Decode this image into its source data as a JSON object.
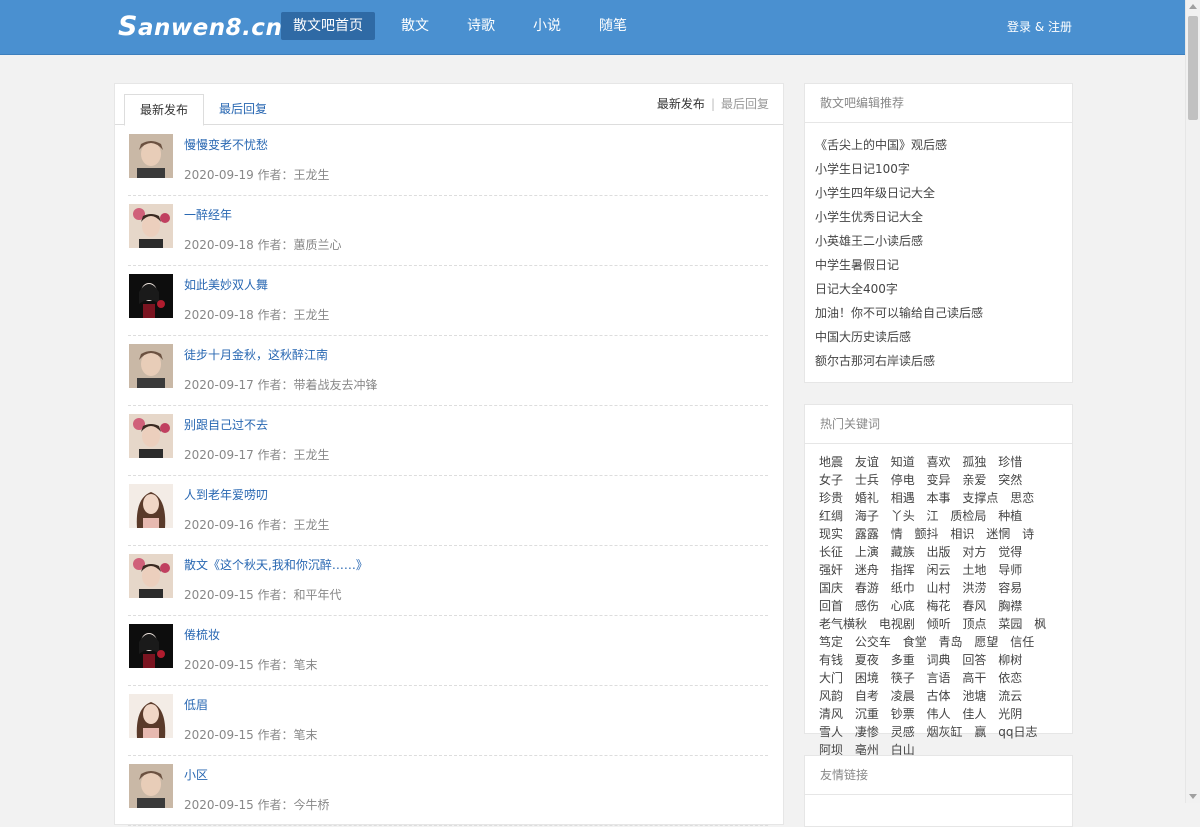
{
  "header": {
    "logo_first": "S",
    "logo_rest": "anwen8.cn",
    "nav": [
      {
        "label": "散文吧首页",
        "active": true
      },
      {
        "label": "散文",
        "active": false
      },
      {
        "label": "诗歌",
        "active": false
      },
      {
        "label": "小说",
        "active": false
      },
      {
        "label": "随笔",
        "active": false
      }
    ],
    "login": "登录 & 注册"
  },
  "main": {
    "tabs": [
      "最新发布",
      "最后回复"
    ],
    "sort": {
      "on": "最新发布",
      "separator": "|",
      "off": "最后回复"
    },
    "articles": [
      {
        "title": "慢慢变老不忧愁",
        "meta": "2020-09-19 作者：王龙生",
        "avatar": "woman-short-hair"
      },
      {
        "title": "一醉经年",
        "meta": "2020-09-18 作者：蕙质兰心",
        "avatar": "woman-flowers"
      },
      {
        "title": "如此美妙双人舞",
        "meta": "2020-09-18 作者：王龙生",
        "avatar": "doll-rose"
      },
      {
        "title": "徒步十月金秋，这秋醉江南",
        "meta": "2020-09-17 作者：带着战友去冲锋",
        "avatar": "woman-short-hair"
      },
      {
        "title": "别跟自己过不去",
        "meta": "2020-09-17 作者：王龙生",
        "avatar": "woman-flowers"
      },
      {
        "title": "人到老年爱唠叨",
        "meta": "2020-09-16 作者：王龙生",
        "avatar": "woman-long-hair"
      },
      {
        "title": "散文《这个秋天,我和你沉醉……》",
        "meta": "2020-09-15 作者：和平年代",
        "avatar": "woman-flowers"
      },
      {
        "title": "倦梳妆",
        "meta": "2020-09-15 作者：笔末",
        "avatar": "doll-rose"
      },
      {
        "title": "低眉",
        "meta": "2020-09-15 作者：笔末",
        "avatar": "woman-long-hair"
      },
      {
        "title": "小区",
        "meta": "2020-09-15 作者：今牛桥",
        "avatar": "woman-short-hair"
      }
    ]
  },
  "sidebar": {
    "recommend_title": "散文吧编辑推荐",
    "recommend": [
      "《舌尖上的中国》观后感",
      "小学生日记100字",
      "小学生四年级日记大全",
      "小学生优秀日记大全",
      "小英雄王二小读后感",
      "中学生暑假日记",
      "日记大全400字",
      "加油！你不可以输给自己读后感",
      "中国大历史读后感",
      "额尔古那河右岸读后感"
    ],
    "keywords_title": "热门关键词",
    "keywords": [
      "地震",
      "友谊",
      "知道",
      "喜欢",
      "孤独",
      "珍惜",
      "女子",
      "士兵",
      "停电",
      "变异",
      "亲爱",
      "突然",
      "珍贵",
      "婚礼",
      "相遇",
      "本事",
      "支撑点",
      "思恋",
      "红绸",
      "海子",
      "丫头",
      "江",
      "质检局",
      "种植",
      "现实",
      "露露",
      "情",
      "颤抖",
      "相识",
      "迷惘",
      "诗",
      "长征",
      "上演",
      "藏族",
      "出版",
      "对方",
      "觉得",
      "强奸",
      "迷舟",
      "指挥",
      "闲云",
      "土地",
      "导师",
      "国庆",
      "春游",
      "纸巾",
      "山村",
      "洪涝",
      "容易",
      "回首",
      "感伤",
      "心底",
      "梅花",
      "春风",
      "胸襟",
      "老气横秋",
      "电视剧",
      "倾听",
      "顶点",
      "菜园",
      "枫",
      "笃定",
      "公交车",
      "食堂",
      "青岛",
      "愿望",
      "信任",
      "有钱",
      "夏夜",
      "多重",
      "词典",
      "回答",
      "柳树",
      "大门",
      "困境",
      "筷子",
      "言语",
      "高干",
      "依恋",
      "风韵",
      "自考",
      "凌晨",
      "古体",
      "池塘",
      "流云",
      "清风",
      "沉重",
      "钞票",
      "伟人",
      "佳人",
      "光阴",
      "雪人",
      "凄惨",
      "灵感",
      "烟灰缸",
      "赢",
      "qq日志",
      "阿坝",
      "亳州",
      "白山"
    ],
    "links_title": "友情链接"
  }
}
